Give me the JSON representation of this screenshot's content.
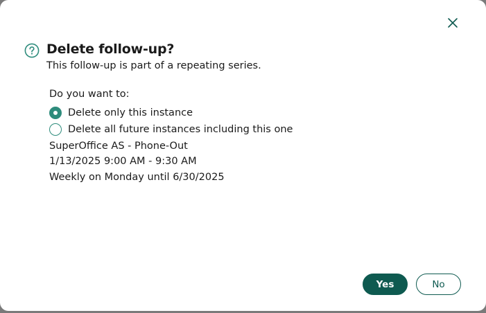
{
  "dialog": {
    "title": "Delete follow-up?",
    "subtitle": "This follow-up is part of a repeating series.",
    "question": "Do you want to:",
    "options": [
      {
        "label": "Delete only this instance",
        "selected": true
      },
      {
        "label": "Delete all future instances including this one",
        "selected": false
      }
    ],
    "details": {
      "subject": "SuperOffice AS - Phone-Out",
      "time": "1/13/2025 9:00 AM - 9:30 AM",
      "recurrence": "Weekly on Monday until 6/30/2025"
    },
    "buttons": {
      "yes_label": "Yes",
      "no_label": "No"
    },
    "icons": {
      "help": "help-circle-icon",
      "close": "close-icon"
    },
    "colors": {
      "accent": "#2e8c7c",
      "primary": "#0e5a50"
    }
  }
}
